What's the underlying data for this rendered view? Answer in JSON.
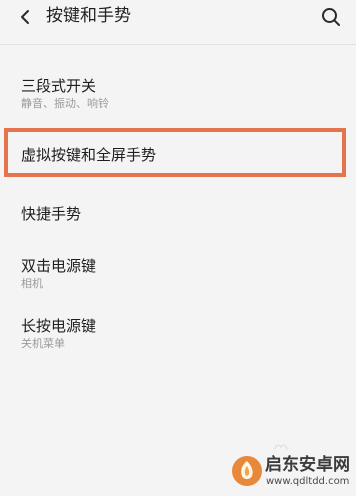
{
  "header": {
    "title": "按键和手势",
    "back_icon": "chevron-left-icon",
    "search_icon": "search-icon"
  },
  "items": [
    {
      "title": "三段式开关",
      "subtitle": "静音、振动、响铃"
    },
    {
      "title": "虚拟按键和全屏手势",
      "subtitle": ""
    },
    {
      "title": "快捷手势",
      "subtitle": ""
    },
    {
      "title": "双击电源键",
      "subtitle": "相机"
    },
    {
      "title": "长按电源键",
      "subtitle": "关机菜单"
    }
  ],
  "highlight_color": "#e5744e",
  "watermark": {
    "name": "启东安卓网",
    "url": "www.qdltdd.com"
  }
}
